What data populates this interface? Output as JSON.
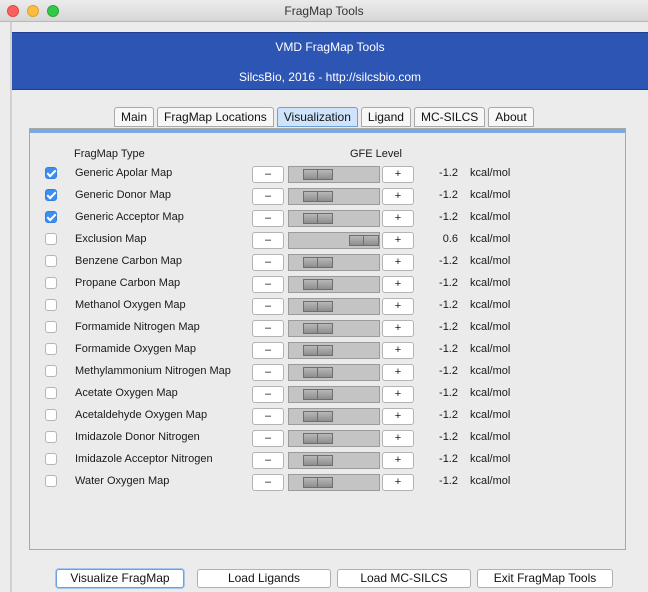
{
  "window": {
    "title": "FragMap Tools"
  },
  "banner": {
    "title": "VMD FragMap Tools",
    "subtitle": "SilcsBio, 2016 - http://silcsbio.com"
  },
  "tabs": [
    {
      "label": "Main",
      "active": false
    },
    {
      "label": "FragMap Locations",
      "active": false
    },
    {
      "label": "Visualization",
      "active": true
    },
    {
      "label": "Ligand",
      "active": false
    },
    {
      "label": "MC-SILCS",
      "active": false
    },
    {
      "label": "About",
      "active": false
    }
  ],
  "table": {
    "col_type": "FragMap Type",
    "col_gfe": "GFE Level",
    "minus_label": "–",
    "plus_label": "+",
    "rows": [
      {
        "label": "Generic Apolar Map",
        "checked": true,
        "value": "-1.2",
        "unit": "kcal/mol",
        "level_fraction": 0.32
      },
      {
        "label": "Generic Donor Map",
        "checked": true,
        "value": "-1.2",
        "unit": "kcal/mol",
        "level_fraction": 0.32
      },
      {
        "label": "Generic Acceptor Map",
        "checked": true,
        "value": "-1.2",
        "unit": "kcal/mol",
        "level_fraction": 0.32
      },
      {
        "label": "Exclusion Map",
        "checked": false,
        "value": "0.6",
        "unit": "kcal/mol",
        "level_fraction": 0.86
      },
      {
        "label": "Benzene Carbon Map",
        "checked": false,
        "value": "-1.2",
        "unit": "kcal/mol",
        "level_fraction": 0.32
      },
      {
        "label": "Propane Carbon Map",
        "checked": false,
        "value": "-1.2",
        "unit": "kcal/mol",
        "level_fraction": 0.32
      },
      {
        "label": "Methanol Oxygen Map",
        "checked": false,
        "value": "-1.2",
        "unit": "kcal/mol",
        "level_fraction": 0.32
      },
      {
        "label": "Formamide Nitrogen Map",
        "checked": false,
        "value": "-1.2",
        "unit": "kcal/mol",
        "level_fraction": 0.32
      },
      {
        "label": "Formamide Oxygen Map",
        "checked": false,
        "value": "-1.2",
        "unit": "kcal/mol",
        "level_fraction": 0.32
      },
      {
        "label": "Methylammonium Nitrogen Map",
        "checked": false,
        "value": "-1.2",
        "unit": "kcal/mol",
        "level_fraction": 0.32
      },
      {
        "label": "Acetate Oxygen Map",
        "checked": false,
        "value": "-1.2",
        "unit": "kcal/mol",
        "level_fraction": 0.32
      },
      {
        "label": "Acetaldehyde Oxygen Map",
        "checked": false,
        "value": "-1.2",
        "unit": "kcal/mol",
        "level_fraction": 0.32
      },
      {
        "label": "Imidazole Donor Nitrogen",
        "checked": false,
        "value": "-1.2",
        "unit": "kcal/mol",
        "level_fraction": 0.32
      },
      {
        "label": "Imidazole Acceptor Nitrogen",
        "checked": false,
        "value": "-1.2",
        "unit": "kcal/mol",
        "level_fraction": 0.32
      },
      {
        "label": "Water Oxygen Map",
        "checked": false,
        "value": "-1.2",
        "unit": "kcal/mol",
        "level_fraction": 0.32
      }
    ]
  },
  "buttons": {
    "visualize": "Visualize FragMap",
    "load_ligands": "Load Ligands",
    "load_mcsilcs": "Load MC-SILCS",
    "exit": "Exit FragMap Tools"
  },
  "colors": {
    "banner": "#2d55b3",
    "active_tab": "#cfe4fb",
    "checkbox_on": "#3b8ff4"
  }
}
